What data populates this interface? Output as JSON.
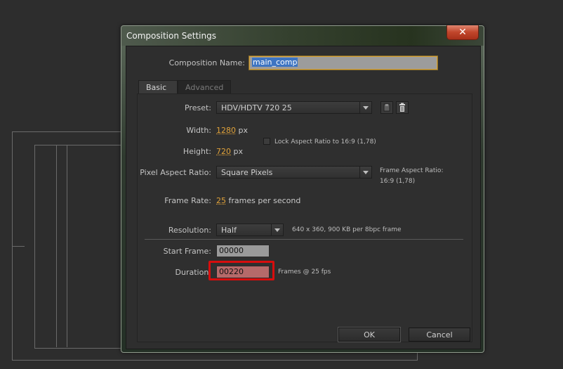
{
  "dialog": {
    "title": "Composition Settings",
    "close_label": "✕",
    "composition_name_label": "Composition Name:",
    "composition_name_value": "main_comp",
    "tabs": [
      {
        "label": "Basic",
        "active": true
      },
      {
        "label": "Advanced",
        "active": false
      }
    ],
    "preset": {
      "label": "Preset:",
      "value": "HDV/HDTV 720 25"
    },
    "width": {
      "label": "Width:",
      "value": "1280",
      "unit": "px"
    },
    "height": {
      "label": "Height:",
      "value": "720",
      "unit": "px"
    },
    "lock_aspect": {
      "label": "Lock Aspect Ratio to 16:9 (1,78)",
      "checked": false
    },
    "pixel_aspect": {
      "label": "Pixel Aspect Ratio:",
      "value": "Square Pixels"
    },
    "frame_aspect": {
      "line1": "Frame Aspect Ratio:",
      "line2": "16:9 (1,78)"
    },
    "frame_rate": {
      "label": "Frame Rate:",
      "value": "25",
      "suffix": "frames per second"
    },
    "resolution": {
      "label": "Resolution:",
      "value": "Half",
      "info": "640 x 360, 900 KB per 8bpc frame"
    },
    "start_frame": {
      "label": "Start Frame:",
      "value": "00000"
    },
    "duration": {
      "label": "Duration:",
      "value": "00220",
      "info": "Frames @ 25 fps"
    },
    "ok_label": "OK",
    "cancel_label": "Cancel"
  },
  "colors": {
    "highlight": "#d80d0d",
    "link_value": "#e0a23a",
    "selection": "#3d74c2"
  }
}
